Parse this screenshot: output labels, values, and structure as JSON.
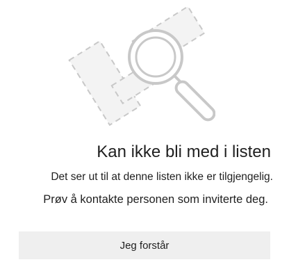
{
  "dialog": {
    "title": "Kan ikke bli med i listen",
    "message_line1": "Det ser ut til at denne listen ikke er tilgjengelig.",
    "message_line2": "Prøv å kontakte personen som inviterte deg.",
    "button_label": "Jeg forstår"
  },
  "illustration": {
    "icon": "list-not-found-magnifier-icon",
    "stroke_color": "#c8c8c8",
    "fill_color": "#f3f3f3"
  },
  "colors": {
    "background": "#ffffff",
    "text": "#1f1f1f",
    "button_background": "#efefef"
  }
}
